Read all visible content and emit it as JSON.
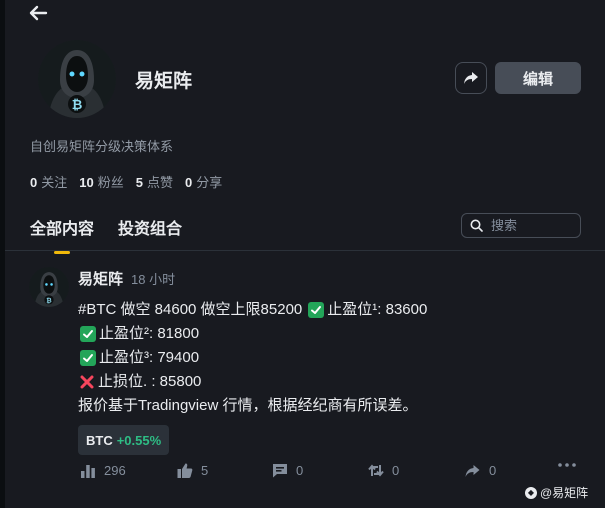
{
  "profile": {
    "name": "易矩阵",
    "bio": "自创易矩阵分级决策体系",
    "edit_label": "编辑",
    "stats": [
      {
        "num": "0",
        "label": "关注"
      },
      {
        "num": "10",
        "label": "粉丝"
      },
      {
        "num": "5",
        "label": "点赞"
      },
      {
        "num": "0",
        "label": "分享"
      }
    ]
  },
  "tabs": [
    {
      "label": "全部内容",
      "active": true
    },
    {
      "label": "投资组合",
      "active": false
    }
  ],
  "search": {
    "placeholder": "搜索"
  },
  "post": {
    "author": "易矩阵",
    "time": "18 小时",
    "line1_text": "#BTC 做空 84600 做空上限85200",
    "line1_tp_label": "止盈位¹: 83600",
    "line2": "止盈位²: 81800",
    "line3": "止盈位³: 79400",
    "line4": "止损位. : 85800",
    "line5": "报价基于Tradingview 行情，根据经纪商有所误差。",
    "tag_symbol": "BTC",
    "tag_change": "+0.55%",
    "views": "296",
    "likes": "5",
    "comments": "0",
    "reposts": "0",
    "shares": "0"
  },
  "watermark": "@易矩阵",
  "colors": {
    "background": "#181a20",
    "accent": "#f0b90b",
    "positive": "#2ebd85",
    "check": "#23a559",
    "cross": "#f6465d"
  }
}
